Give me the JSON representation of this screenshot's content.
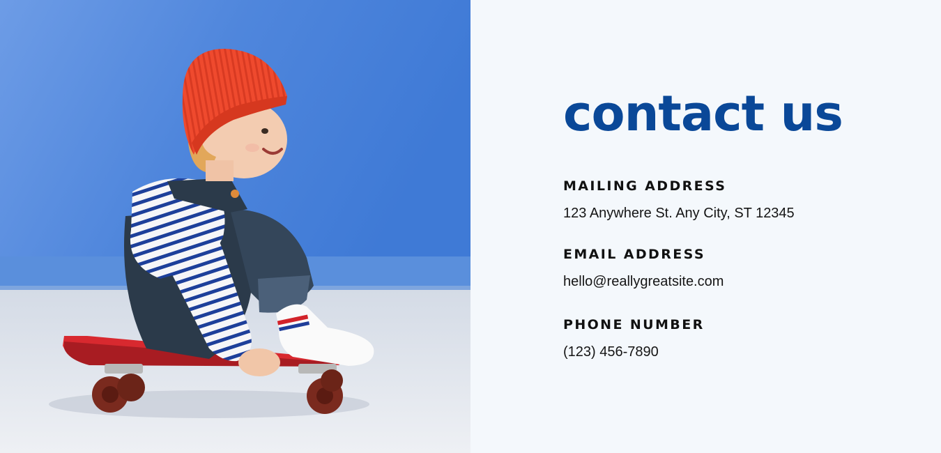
{
  "page": {
    "title": "contact us",
    "accent_color": "#0a4898",
    "background_color": "#f4f8fc"
  },
  "photo": {
    "description_name": "child-on-skateboard-photo",
    "backdrop_color": "#4f86dc"
  },
  "contact": {
    "mailing": {
      "label": "MAILING ADDRESS",
      "value": "123 Anywhere St. Any City, ST 12345"
    },
    "email": {
      "label": "EMAIL ADDRESS",
      "value": "hello@reallygreatsite.com"
    },
    "phone": {
      "label": "PHONE NUMBER",
      "value": "(123) 456-7890"
    }
  }
}
